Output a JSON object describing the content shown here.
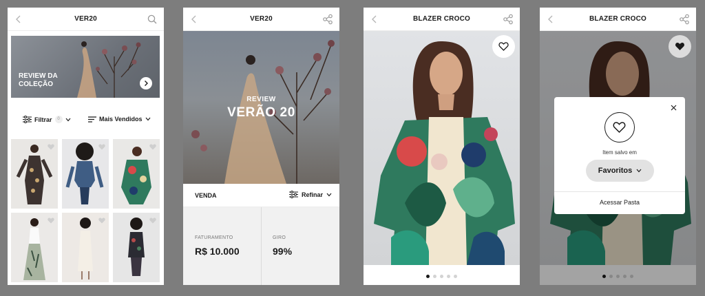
{
  "screen1": {
    "title": "VER20",
    "banner_text": "REVIEW DA COLEÇÃO",
    "filter_label": "Filtrar",
    "filter_count": "0",
    "sort_label": "Mais Vendidos"
  },
  "screen2": {
    "title": "VER20",
    "hero_kicker": "REVIEW",
    "hero_title": "VERÃO 20",
    "section_label": "VENDA",
    "refine_label": "Refinar",
    "stats": [
      {
        "label": "FATURAMENTO",
        "value": "R$ 10.000"
      },
      {
        "label": "GIRO",
        "value": "99%"
      }
    ]
  },
  "screen3": {
    "title": "BLAZER CROCO",
    "carousel_total": 5,
    "carousel_active": 1
  },
  "screen4": {
    "title": "BLAZER CROCO",
    "modal": {
      "message": "Item salvo em",
      "folder": "Favoritos",
      "link": "Acessar Pasta"
    },
    "carousel_total": 5,
    "carousel_active": 1
  },
  "colors": {
    "background": "#7d7d7d",
    "text": "#1a1a1a",
    "pill": "#e2e2e2",
    "stats_bg": "#f1f1f1"
  },
  "icons": [
    "back-icon",
    "search-icon",
    "share-icon",
    "heart-icon",
    "filter-icon",
    "sort-icon",
    "chevron-down-icon",
    "chevron-right-icon",
    "close-icon"
  ]
}
